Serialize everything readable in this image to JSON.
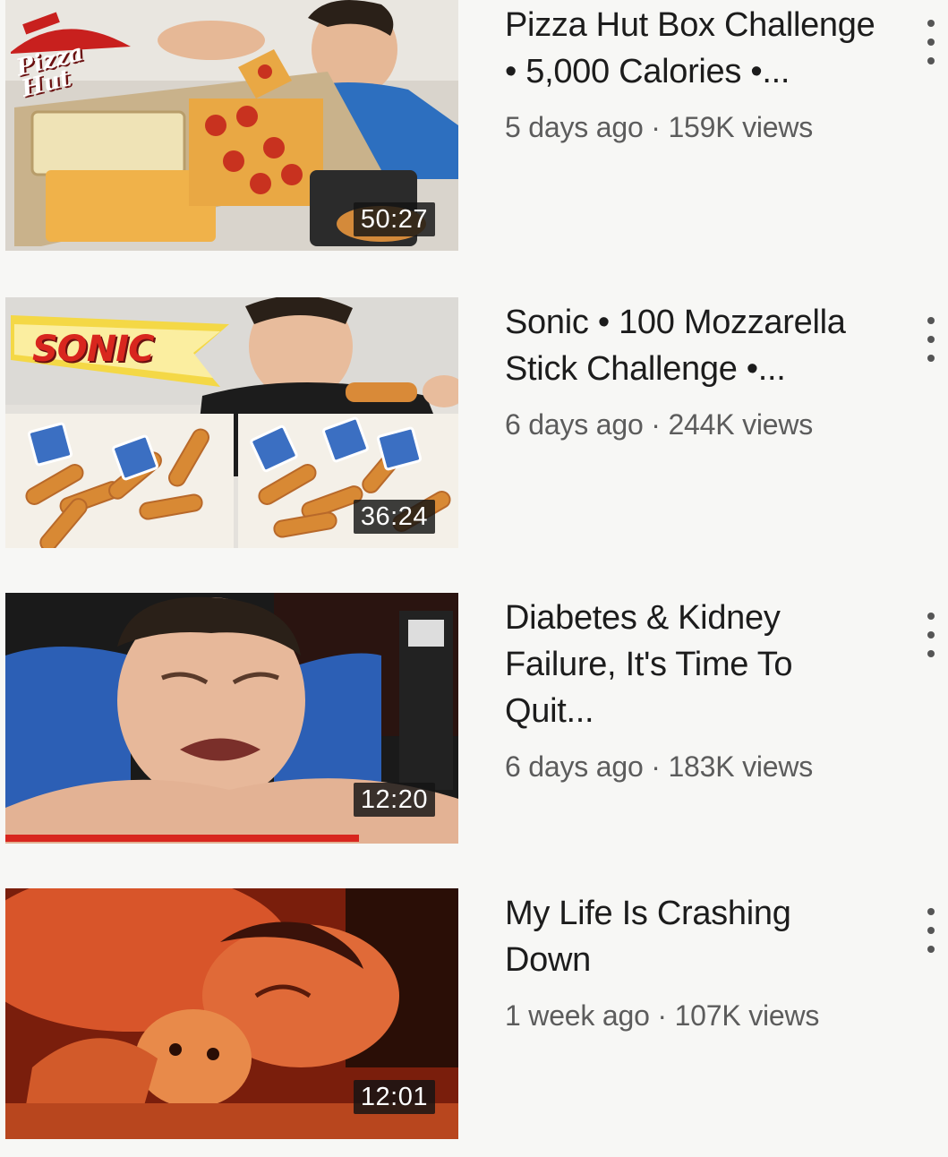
{
  "videos": [
    {
      "title": "Pizza Hut Box Challenge • 5,000 Calories •...",
      "age": "5 days ago",
      "sep": "·",
      "views": "159K views",
      "duration": "50:27",
      "brand_logo_text": "Pizza Hut",
      "watched_fraction": 0
    },
    {
      "title": "Sonic • 100 Mozzarella Stick Challenge •...",
      "age": "6 days ago",
      "sep": "·",
      "views": "244K views",
      "duration": "36:24",
      "brand_logo_text": "SONIC",
      "watched_fraction": 0
    },
    {
      "title": "Diabetes & Kidney Failure, It's Time To Quit...",
      "age": "6 days ago",
      "sep": "·",
      "views": "183K views",
      "duration": "12:20",
      "watched_fraction": 0.78
    },
    {
      "title": "My Life Is Crashing Down",
      "age": "1 week ago",
      "sep": "·",
      "views": "107K views",
      "duration": "12:01",
      "watched_fraction": 0
    }
  ],
  "colors": {
    "progress": "#d8261e",
    "title_text": "#1c1c1c",
    "meta_text": "#5c5c5c",
    "background": "#f7f7f5"
  },
  "icons": {
    "menu": "more-vertical-icon"
  }
}
